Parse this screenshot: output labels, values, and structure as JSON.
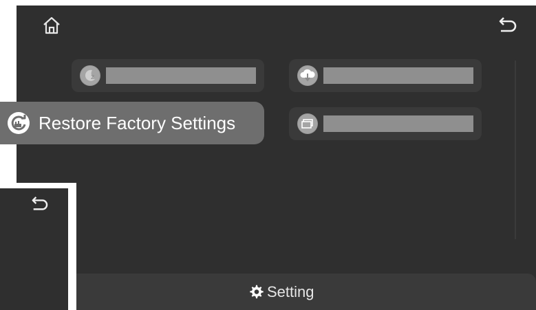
{
  "restore": {
    "label": "Restore Factory Settings"
  },
  "footer": {
    "title": "Setting"
  },
  "icons": {
    "home": "home-icon",
    "back": "back-icon",
    "sleep": "sleep-icon",
    "cloud_download": "cloud-download-icon",
    "restore": "restore-icon",
    "windows": "windows-icon",
    "gear": "gear-icon"
  }
}
